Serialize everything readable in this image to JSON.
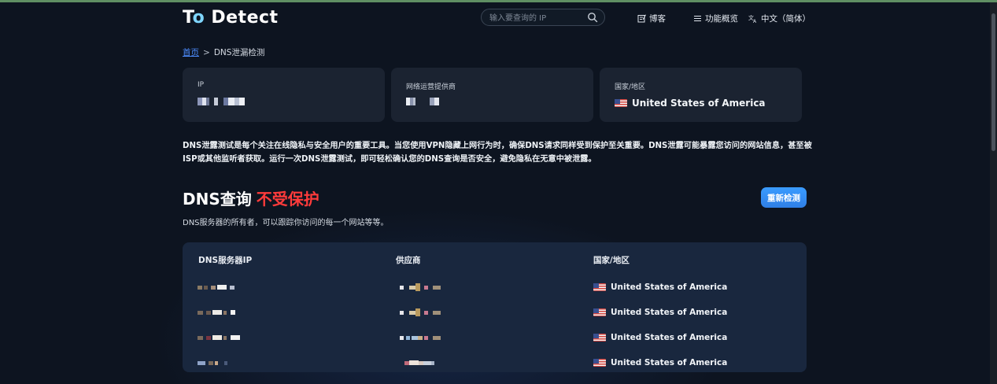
{
  "header": {
    "logo_part1": "T",
    "logo_part2": "o",
    "logo_part3": " Detect",
    "search_placeholder": "输入要查询的 IP",
    "nav_blog": "博客",
    "nav_features": "功能概览",
    "nav_language": "中文（简体）"
  },
  "breadcrumb": {
    "home": "首页",
    "separator": ">",
    "current": "DNS泄漏检测"
  },
  "cards": [
    {
      "label": "IP",
      "value": ""
    },
    {
      "label": "网络运营提供商",
      "value": ""
    },
    {
      "label": "国家/地区",
      "value": "United States of America"
    }
  ],
  "description": "DNS泄露测试是每个关注在线隐私与安全用户的重要工具。当您使用VPN隐藏上网行为时，确保DNS请求同样受到保护至关重要。DNS泄露可能暴露您访问的网站信息，甚至被ISP或其他监听者获取。运行一次DNS泄露测试，即可轻松确认您的DNS查询是否安全，避免隐私在无意中被泄露。",
  "status": {
    "title": "DNS查询",
    "danger": "不受保护",
    "subtitle": "DNS服务器的所有者，可以跟踪你访问的每一个网站等等。",
    "recheck": "重新检测"
  },
  "table": {
    "headers": [
      "DNS服务器IP",
      "供应商",
      "国家/地区"
    ],
    "rows": [
      {
        "country": "United States of America"
      },
      {
        "country": "United States of America"
      },
      {
        "country": "United States of America"
      },
      {
        "country": "United States of America"
      }
    ]
  },
  "colors": {
    "background": "#0d1420",
    "card": "#1b2331",
    "danger": "#ff3b3b",
    "button": "#3a9cff",
    "link": "#4d8dff"
  },
  "icons": [
    "search-icon",
    "blog-icon",
    "menu-icon",
    "translate-icon",
    "us-flag-icon"
  ]
}
